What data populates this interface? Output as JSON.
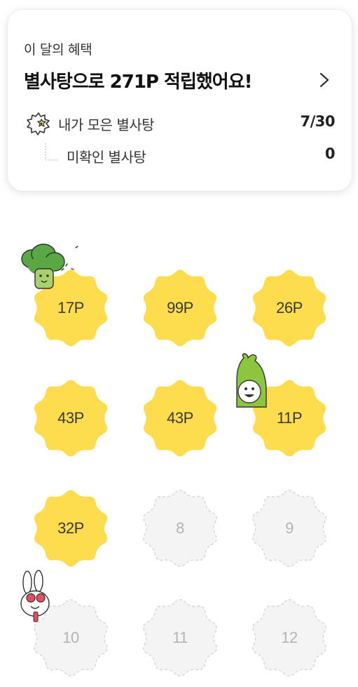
{
  "summary": {
    "subtitle": "이 달의 혜택",
    "title": "별사탕으로 271P 적립했어요!",
    "collected": {
      "label": "내가 모은 별사탕",
      "value": "7/30"
    },
    "unchecked": {
      "label": "미확인 별사탕",
      "value": "0"
    }
  },
  "badges": [
    {
      "label": "17P",
      "earned": true
    },
    {
      "label": "99P",
      "earned": true
    },
    {
      "label": "26P",
      "earned": true
    },
    {
      "label": "43P",
      "earned": true
    },
    {
      "label": "43P",
      "earned": true
    },
    {
      "label": "11P",
      "earned": true
    },
    {
      "label": "32P",
      "earned": true
    },
    {
      "label": "8",
      "earned": false
    },
    {
      "label": "9",
      "earned": false
    },
    {
      "label": "10",
      "earned": false
    },
    {
      "label": "11",
      "earned": false
    },
    {
      "label": "12",
      "earned": false
    }
  ],
  "colors": {
    "earned_fill": "#fddc4e",
    "locked_fill": "#f4f4f4",
    "locked_stroke": "#d6d6d6"
  },
  "icons": {
    "chevron": "chevron-right-icon",
    "candy": "star-candy-icon"
  }
}
